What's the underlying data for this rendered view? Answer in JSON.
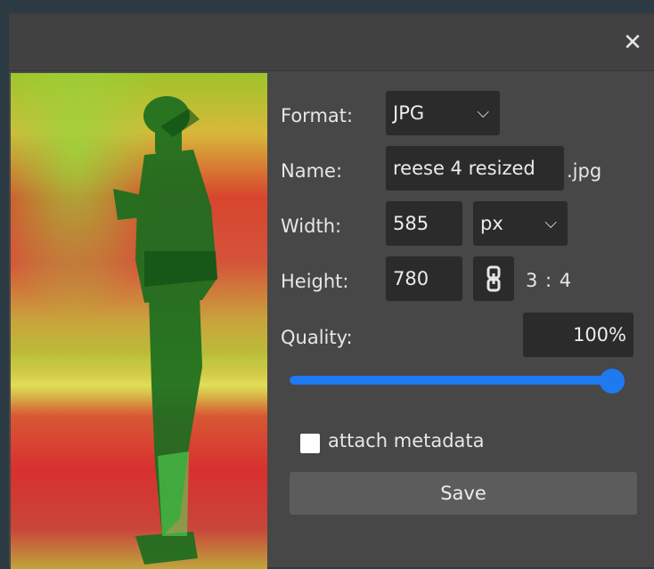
{
  "dialog": {
    "close_glyph": "✕"
  },
  "form": {
    "format": {
      "label": "Format:",
      "value": "JPG"
    },
    "name": {
      "label": "Name:",
      "value": "reese 4 resized",
      "extension": ".jpg"
    },
    "width": {
      "label": "Width:",
      "value": "585",
      "unit": "px"
    },
    "height": {
      "label": "Height:",
      "value": "780",
      "ratio": "3 : 4"
    },
    "quality": {
      "label": "Quality:",
      "value": "100%",
      "level": 1.0
    },
    "metadata": {
      "label": "attach metadata",
      "checked": false
    },
    "save_label": "Save"
  },
  "icons": {
    "close": "close-icon",
    "chevron": "chevron-down-icon",
    "link": "link-icon"
  },
  "colors": {
    "accent": "#1e7af0",
    "panel": "#474747",
    "field": "#2b2b2b",
    "button": "#5c5c5c"
  }
}
